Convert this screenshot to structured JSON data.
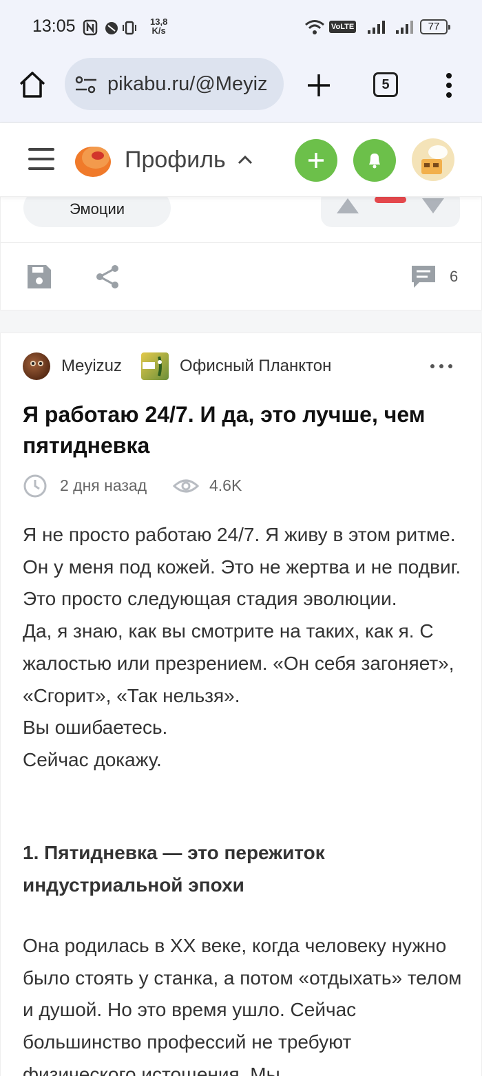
{
  "status_bar": {
    "time": "13:05",
    "speed_value": "13,8",
    "speed_unit": "K/s",
    "volte": "VoLTE",
    "battery": "77"
  },
  "browser": {
    "url": "pikabu.ru/@Meyiz",
    "tab_count": "5"
  },
  "site_header": {
    "section_label": "Профиль"
  },
  "previous_post": {
    "emotions_label": "Эмоции",
    "comments_count": "6"
  },
  "post": {
    "author": "Meyizuz",
    "community": "Офисный Планктон",
    "title": "Я работаю 24/7. И да, это лучше, чем пятидневка",
    "time_ago": "2 дня назад",
    "views": "4.6K",
    "paragraphs": [
      "Я не просто работаю 24/7. Я живу в этом ритме. Он у меня под кожей. Это не жертва и не подвиг. Это просто следующая стадия эволюции.",
      "Да, я знаю, как вы смотрите на таких, как я. С жалостью или презрением. «Он себя загоняет», «Сгорит», «Так нельзя».",
      "Вы ошибаетесь.",
      "Сейчас докажу."
    ],
    "section_heading": "1. Пятидневка — это пережиток индустриальной эпохи",
    "section_paragraph": "Она родилась в XX веке, когда человеку нужно было стоять у станка, а потом «отдыхать» телом и душой. Но это время ушло. Сейчас большинство профессий не требуют физического истощения. Мы"
  },
  "colors": {
    "green_button": "#6cc04a",
    "downvote_active": "#e5484d",
    "status_bg": "#f1f3fb"
  }
}
